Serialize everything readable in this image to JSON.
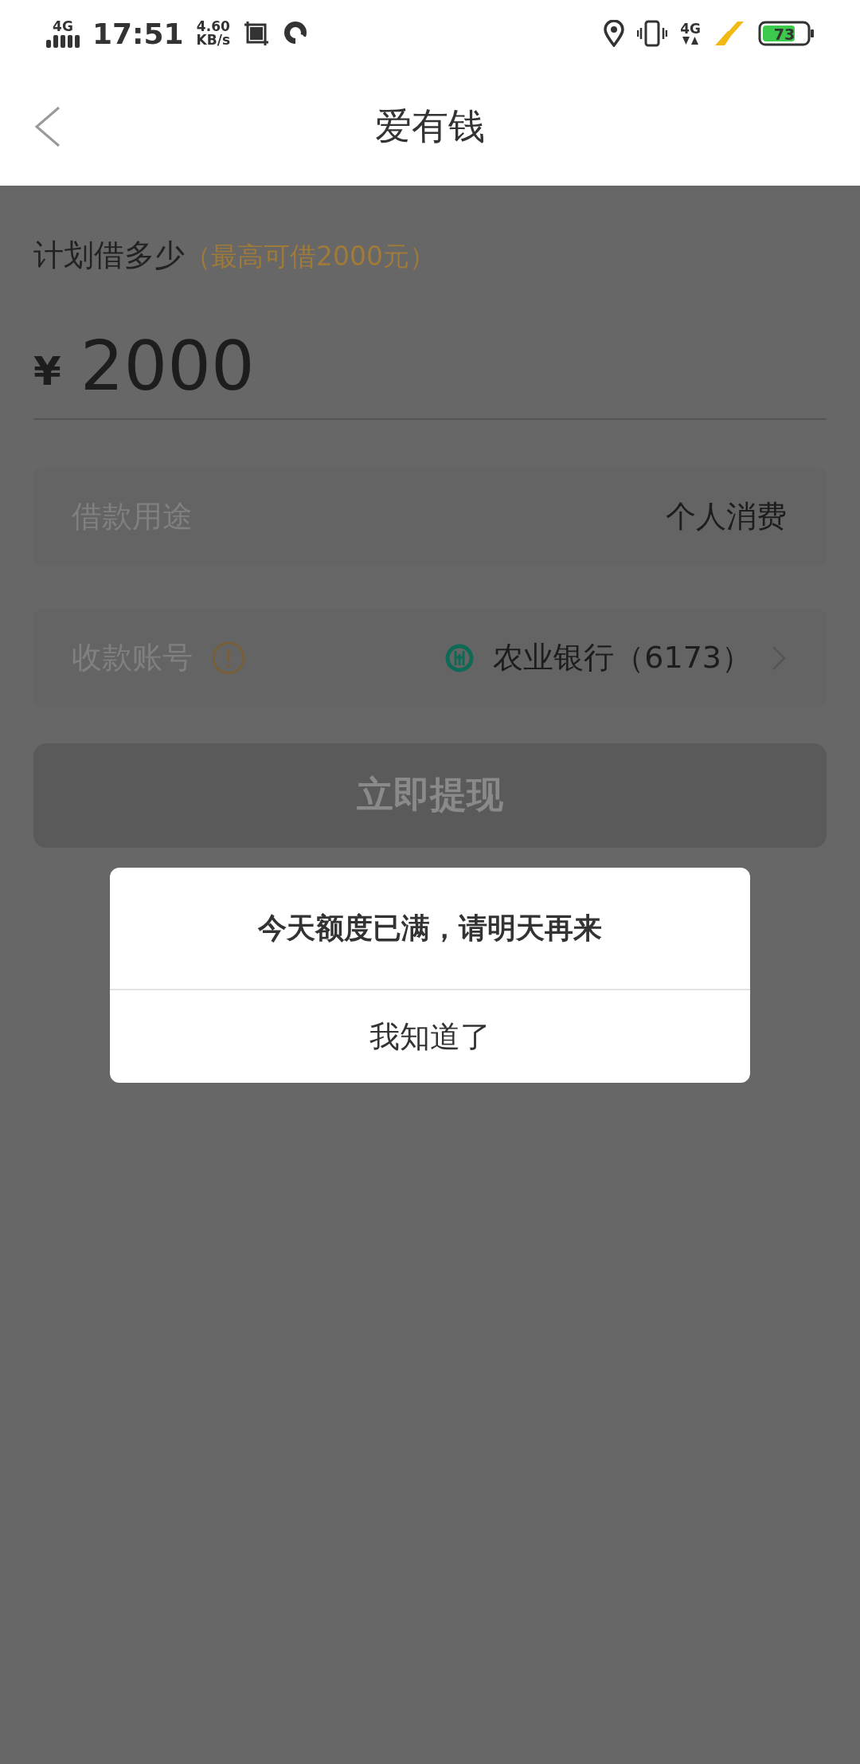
{
  "status_bar": {
    "network": "4G",
    "time": "17:51",
    "speed_value": "4.60",
    "speed_unit": "KB/s",
    "mobile_data": "4G",
    "battery": "73"
  },
  "header": {
    "title": "爱有钱"
  },
  "amount_section": {
    "label": "计划借多少",
    "hint": "（最高可借2000元）",
    "currency": "¥",
    "value": "2000"
  },
  "rows": [
    {
      "kind": "plain",
      "label": "借款用途",
      "value": "个人消费"
    },
    {
      "kind": "account",
      "label": "收款账号",
      "value": "农业银行（6173）"
    }
  ],
  "submit_button": {
    "label": "立即提现",
    "disabled": true
  },
  "dialog": {
    "message": "今天额度已满，请明天再来",
    "button": "我知道了"
  }
}
